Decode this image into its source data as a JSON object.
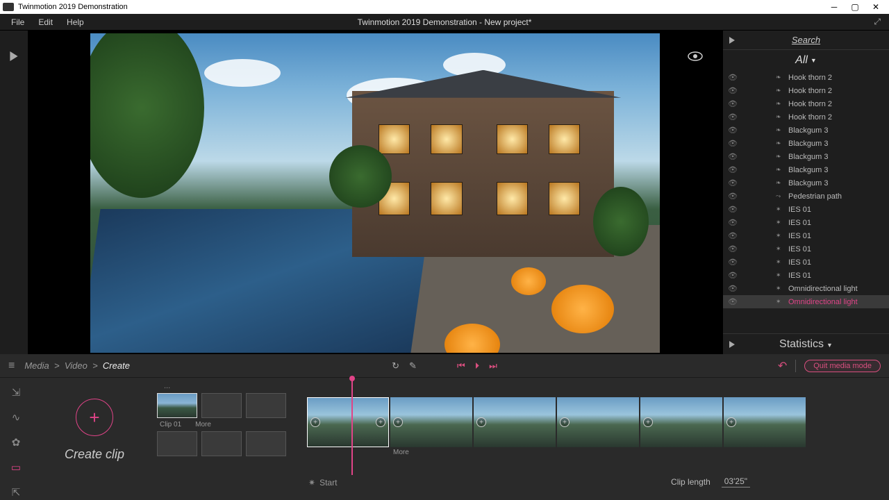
{
  "titlebar": {
    "text": "Twinmotion 2019 Demonstration"
  },
  "menubar": {
    "items": [
      "File",
      "Edit",
      "Help"
    ],
    "title": "Twinmotion 2019 Demonstration - New project*"
  },
  "rightpanel": {
    "search": "Search",
    "filter": "All",
    "items": [
      {
        "label": "Hook thorn 2",
        "icon": "plant"
      },
      {
        "label": "Hook thorn 2",
        "icon": "plant"
      },
      {
        "label": "Hook thorn 2",
        "icon": "plant"
      },
      {
        "label": "Hook thorn 2",
        "icon": "plant"
      },
      {
        "label": "Blackgum 3",
        "icon": "plant"
      },
      {
        "label": "Blackgum 3",
        "icon": "plant"
      },
      {
        "label": "Blackgum 3",
        "icon": "plant"
      },
      {
        "label": "Blackgum 3",
        "icon": "plant"
      },
      {
        "label": "Blackgum 3",
        "icon": "plant"
      },
      {
        "label": "Pedestrian path",
        "icon": "path"
      },
      {
        "label": "IES 01",
        "icon": "light"
      },
      {
        "label": "IES 01",
        "icon": "light"
      },
      {
        "label": "IES 01",
        "icon": "light"
      },
      {
        "label": "IES 01",
        "icon": "light"
      },
      {
        "label": "IES 01",
        "icon": "light"
      },
      {
        "label": "IES 01",
        "icon": "light"
      },
      {
        "label": "Omnidirectional light",
        "icon": "light"
      },
      {
        "label": "Omnidirectional light",
        "icon": "light",
        "selected": true
      }
    ],
    "stats": "Statistics"
  },
  "bottom": {
    "breadcrumb": [
      "Media",
      "Video",
      "Create"
    ],
    "quit": "Quit media mode",
    "create_label": "Create clip",
    "clip01": "Clip 01",
    "more": "More",
    "start": "Start",
    "cliplen_label": "Clip length",
    "cliplen_value": "03'25\"",
    "frame_more": "More"
  }
}
